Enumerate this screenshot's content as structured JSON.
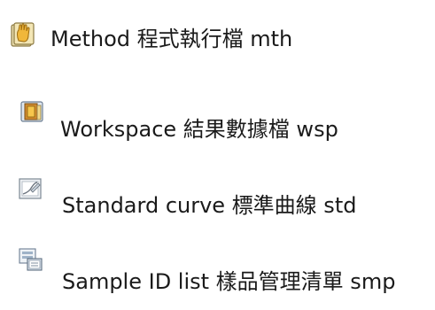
{
  "items": [
    {
      "icon": "method-hand-icon",
      "label": "Method  程式執行檔 mth"
    },
    {
      "icon": "workspace-icon",
      "label": "Workspace 結果數據檔 wsp"
    },
    {
      "icon": "standard-curve-icon",
      "label": "Standard curve 標準曲線 std"
    },
    {
      "icon": "sample-id-list-icon",
      "label": "Sample ID list 樣品管理清單 smp"
    }
  ]
}
